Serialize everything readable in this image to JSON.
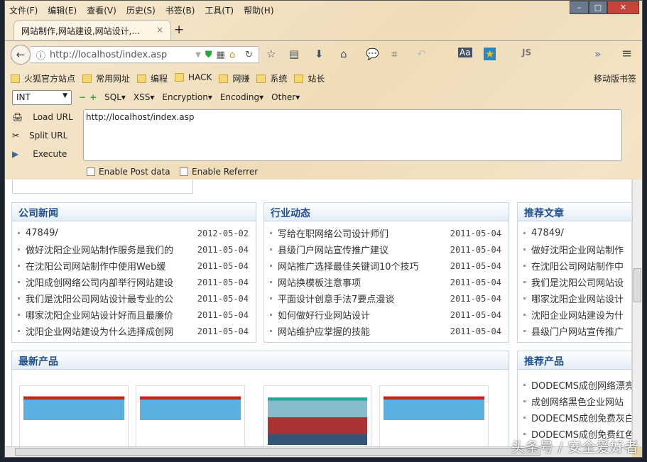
{
  "menu": [
    "文件(F)",
    "编辑(E)",
    "查看(V)",
    "历史(S)",
    "书签(B)",
    "工具(T)",
    "帮助(H)"
  ],
  "tab": {
    "title": "网站制作,网站建设,网站设计,...",
    "close": "×",
    "new": "+"
  },
  "nav": {
    "url": "http://localhost/index.asp"
  },
  "bookmarks": [
    "火狐官方站点",
    "常用网址",
    "编程",
    "HACK",
    "网赚",
    "系统",
    "站长"
  ],
  "mobile_bookmarks": "移动版书签",
  "hackbar": {
    "select": "INT",
    "menus": [
      "SQL▾",
      "XSS▾",
      "Encryption▾",
      "Encoding▾",
      "Other▾"
    ],
    "load": "Load URL",
    "split": "Split URL",
    "execute": "Execute",
    "url": "http://localhost/index.asp",
    "post": "Enable Post data",
    "referrer": "Enable Referrer"
  },
  "panels": {
    "company_news": {
      "title": "公司新闻",
      "items": [
        [
          "47849/",
          "2012-05-02"
        ],
        [
          "做好沈阳企业网站制作服务是我们的",
          "2011-05-04"
        ],
        [
          "在沈阳公司网站制作中使用Web缓",
          "2011-05-04"
        ],
        [
          "沈阳成创网络公司内部举行网站建设",
          "2011-05-04"
        ],
        [
          "我们是沈阳公司网站设计最专业的公",
          "2011-05-04"
        ],
        [
          "哪家沈阳企业网站设计好而且最廉价",
          "2011-05-04"
        ],
        [
          "沈阳企业网站建设为什么选择成创网",
          "2011-05-04"
        ]
      ]
    },
    "industry": {
      "title": "行业动态",
      "items": [
        [
          "写给在职网络公司设计师们",
          "2011-05-04"
        ],
        [
          "县级门户网站宣传推广建议",
          "2011-05-04"
        ],
        [
          "网站推广选择最佳关键词10个技巧",
          "2011-05-04"
        ],
        [
          "网站换模板注意事项",
          "2011-05-04"
        ],
        [
          "平面设计创意手法7要点漫谈",
          "2011-05-04"
        ],
        [
          "如何做好行业网站设计",
          "2011-05-04"
        ],
        [
          "网站维护应掌握的技能",
          "2011-05-04"
        ]
      ]
    },
    "recommended": {
      "title": "推荐文章",
      "items": [
        "47849/",
        "做好沈阳企业网站制作",
        "在沈阳公司网站制作中",
        "我们是沈阳公司网站设",
        "哪家沈阳企业网站设计",
        "沈阳企业网站建设为什",
        "县级门户网站宣传推广"
      ]
    },
    "products": {
      "title": "最新产品"
    },
    "rec_products": {
      "title": "推荐产品",
      "items": [
        "DODECMS成创网络漂亮企",
        "成创网络黑色企业网站",
        "DODECMS成创免费灰白企",
        "DODECMS成创免费红色"
      ]
    }
  },
  "watermark": "头条号 / 安全爱好者"
}
